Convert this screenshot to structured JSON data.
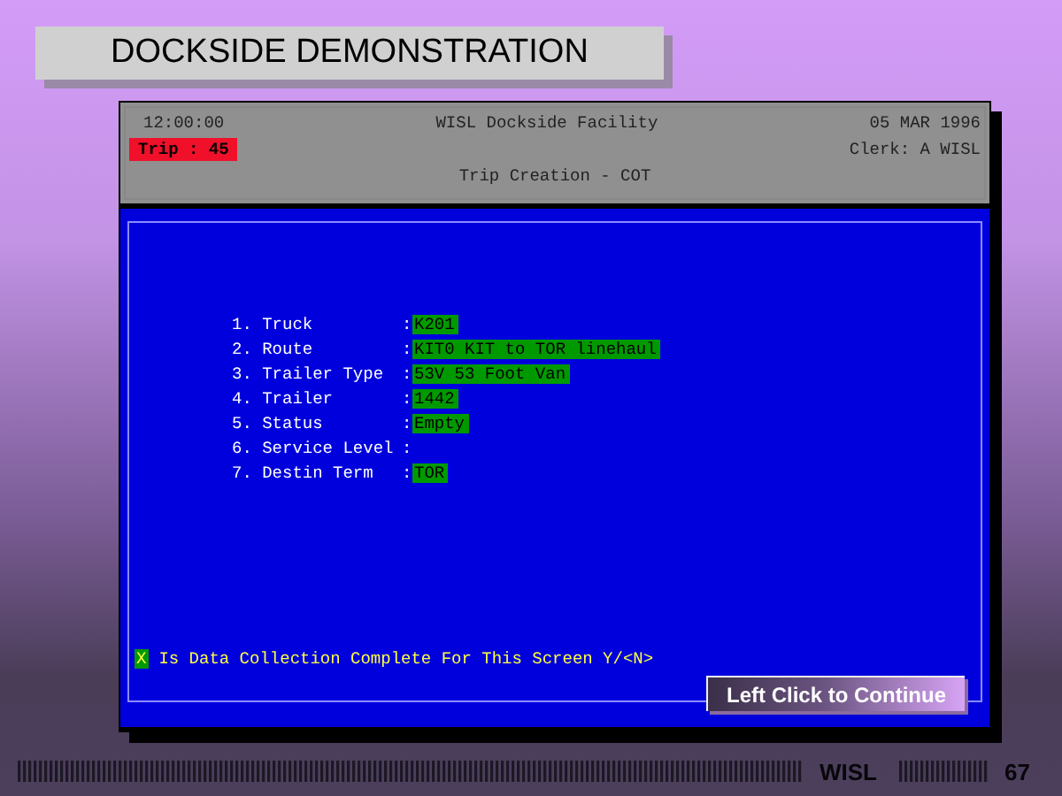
{
  "slide": {
    "title": "DOCKSIDE DEMONSTRATION",
    "footer_label": "WISL",
    "page_number": "67"
  },
  "terminal": {
    "header": {
      "time": "12:00:00",
      "facility": "WISL Dockside Facility",
      "date": "05 MAR 1996",
      "trip": "Trip : 45",
      "clerk": "Clerk: A WISL",
      "screen_title": "Trip Creation - COT"
    },
    "fields": [
      {
        "label": "1. Truck",
        "separator": ":",
        "value": "K201"
      },
      {
        "label": "2. Route",
        "separator": ":",
        "value": "KIT0 KIT to TOR linehaul"
      },
      {
        "label": "3. Trailer Type",
        "separator": ":",
        "value": "53V 53 Foot Van"
      },
      {
        "label": "4. Trailer",
        "separator": ":",
        "value": "1442"
      },
      {
        "label": "5. Status",
        "separator": ":",
        "value": "Empty"
      },
      {
        "label": "6. Service Level",
        "separator": ":"
      },
      {
        "label": "7. Destin Term",
        "separator": ":",
        "value": "TOR"
      }
    ],
    "prompt": {
      "cursor": "X",
      "text": "Is Data Collection Complete For This Screen Y/<N>"
    }
  },
  "continue_button": "Left Click to Continue"
}
